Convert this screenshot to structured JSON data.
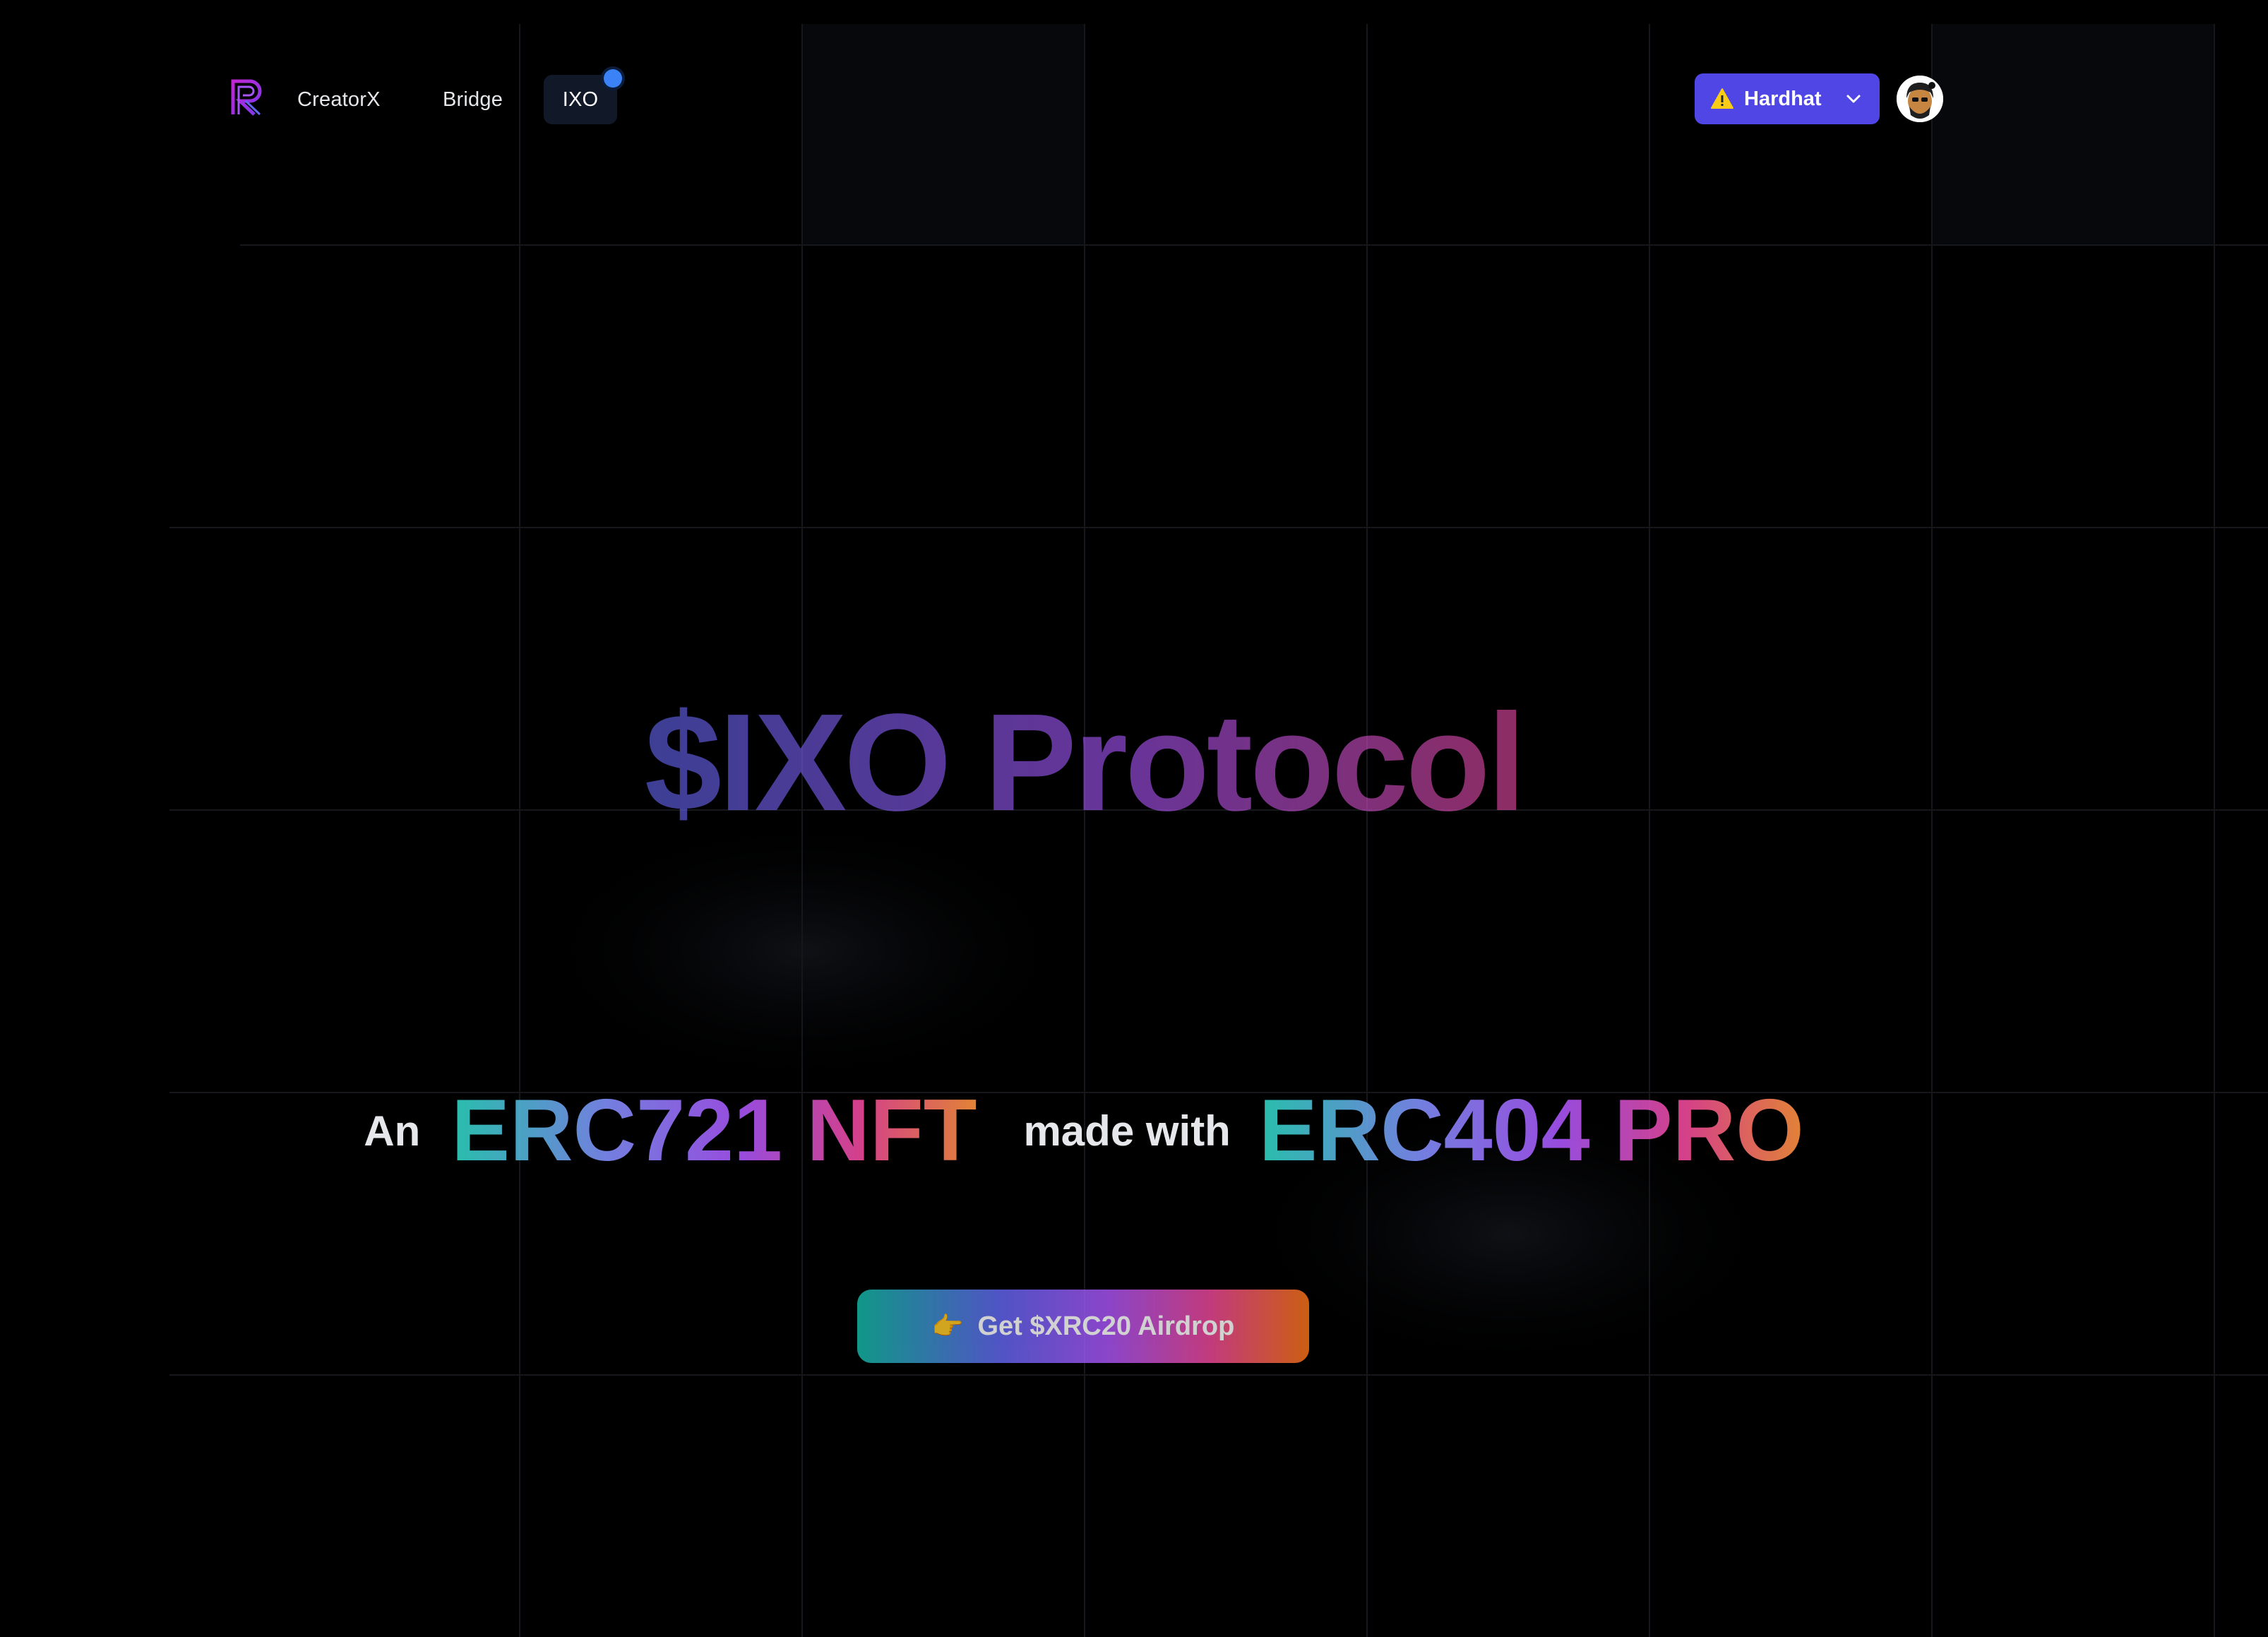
{
  "nav": {
    "logo": "R",
    "links": [
      {
        "label": "CreatorX"
      },
      {
        "label": "Bridge"
      },
      {
        "label": "IXO",
        "active": true
      }
    ],
    "network_button": {
      "label": "Hardhat",
      "icon": "warning-icon",
      "chevron": "chevron-down-icon"
    },
    "avatar": "avatar"
  },
  "hero": {
    "title": "$IXO Protocol",
    "tagline": {
      "prefix": "An",
      "highlight1": "ERC721 NFT",
      "middle": "made with",
      "highlight2": "ERC404 PRO"
    },
    "cta": {
      "emoji": "👉",
      "label": "Get $XRC20 Airdrop"
    }
  },
  "colors": {
    "background": "#000000",
    "network_button": "#4f46e5",
    "notification_dot": "#3b82f6",
    "gradient": [
      "#14b8a6",
      "#6366f1",
      "#a855f7",
      "#ec4899",
      "#f97316"
    ]
  }
}
